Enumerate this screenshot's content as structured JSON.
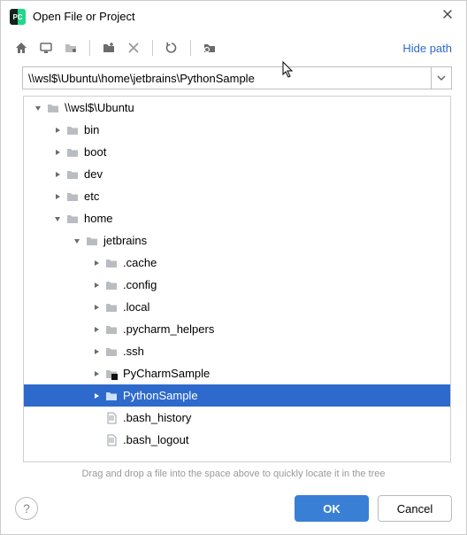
{
  "window": {
    "title": "Open File or Project"
  },
  "toolbar": {
    "hide_path": "Hide path"
  },
  "path": {
    "value": "\\\\wsl$\\Ubuntu\\home\\jetbrains\\PythonSample"
  },
  "tree": {
    "rows": [
      {
        "depth": 0,
        "expand": "open",
        "icon": "folder",
        "label": "\\\\wsl$\\Ubuntu",
        "selected": false
      },
      {
        "depth": 1,
        "expand": "closed",
        "icon": "folder",
        "label": "bin",
        "selected": false
      },
      {
        "depth": 1,
        "expand": "closed",
        "icon": "folder",
        "label": "boot",
        "selected": false
      },
      {
        "depth": 1,
        "expand": "closed",
        "icon": "folder",
        "label": "dev",
        "selected": false
      },
      {
        "depth": 1,
        "expand": "closed",
        "icon": "folder",
        "label": "etc",
        "selected": false
      },
      {
        "depth": 1,
        "expand": "open",
        "icon": "folder",
        "label": "home",
        "selected": false
      },
      {
        "depth": 2,
        "expand": "open",
        "icon": "folder",
        "label": "jetbrains",
        "selected": false
      },
      {
        "depth": 3,
        "expand": "closed",
        "icon": "folder",
        "label": ".cache",
        "selected": false
      },
      {
        "depth": 3,
        "expand": "closed",
        "icon": "folder",
        "label": ".config",
        "selected": false
      },
      {
        "depth": 3,
        "expand": "closed",
        "icon": "folder",
        "label": ".local",
        "selected": false
      },
      {
        "depth": 3,
        "expand": "closed",
        "icon": "folder",
        "label": ".pycharm_helpers",
        "selected": false
      },
      {
        "depth": 3,
        "expand": "closed",
        "icon": "folder",
        "label": ".ssh",
        "selected": false
      },
      {
        "depth": 3,
        "expand": "closed",
        "icon": "project",
        "label": "PyCharmSample",
        "selected": false
      },
      {
        "depth": 3,
        "expand": "closed",
        "icon": "folder",
        "label": "PythonSample",
        "selected": true
      },
      {
        "depth": 3,
        "expand": "none",
        "icon": "file",
        "label": ".bash_history",
        "selected": false
      },
      {
        "depth": 3,
        "expand": "none",
        "icon": "file",
        "label": ".bash_logout",
        "selected": false
      }
    ]
  },
  "hint": "Drag and drop a file into the space above to quickly locate it in the tree",
  "buttons": {
    "ok": "OK",
    "cancel": "Cancel"
  }
}
